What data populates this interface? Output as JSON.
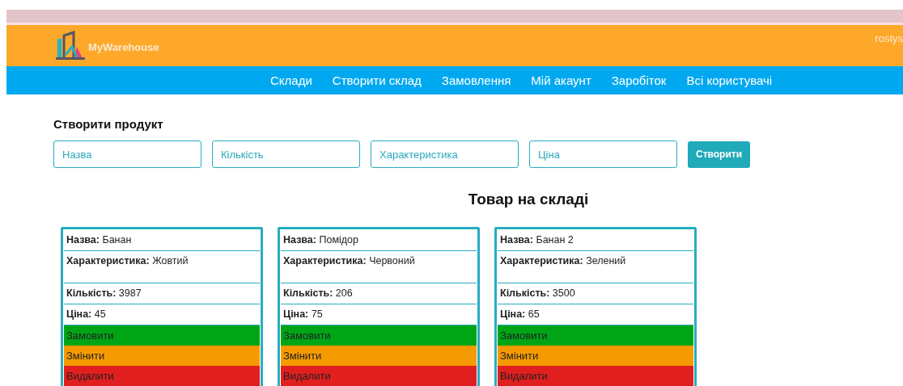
{
  "header": {
    "brand": "MyWarehouse",
    "user": "rostys"
  },
  "nav": [
    "Склади",
    "Створити склад",
    "Замовлення",
    "Мій акаунт",
    "Заробіток",
    "Всі користувачі"
  ],
  "form": {
    "title": "Створити продукт",
    "fields": [
      {
        "placeholder": "Назва"
      },
      {
        "placeholder": "Кількість"
      },
      {
        "placeholder": "Характеристика"
      },
      {
        "placeholder": "Ціна"
      }
    ],
    "submit": "Створити"
  },
  "section_title": "Товар на складі",
  "products": [
    {
      "fields": [
        {
          "label": "Назва:",
          "value": "Банан"
        },
        {
          "label": "Характеристика:",
          "value": "Жовтий"
        },
        {
          "label": "Кількість:",
          "value": "3987"
        },
        {
          "label": "Ціна:",
          "value": "45"
        }
      ],
      "actions": [
        {
          "kind": "order",
          "label": "Замовити"
        },
        {
          "kind": "edit",
          "label": "Змінити"
        },
        {
          "kind": "delete",
          "label": "Видалити"
        }
      ]
    },
    {
      "fields": [
        {
          "label": "Назва:",
          "value": "Помідор"
        },
        {
          "label": "Характеристика:",
          "value": "Червоний"
        },
        {
          "label": "Кількість:",
          "value": "206"
        },
        {
          "label": "Ціна:",
          "value": "75"
        }
      ],
      "actions": [
        {
          "kind": "order",
          "label": "Замовити"
        },
        {
          "kind": "edit",
          "label": "Змінити"
        },
        {
          "kind": "delete",
          "label": "Видалити"
        }
      ]
    },
    {
      "fields": [
        {
          "label": "Назва:",
          "value": "Банан 2"
        },
        {
          "label": "Характеристика:",
          "value": "Зелений"
        },
        {
          "label": "Кількість:",
          "value": "3500"
        },
        {
          "label": "Ціна:",
          "value": "65"
        }
      ],
      "actions": [
        {
          "kind": "order",
          "label": "Замовити"
        },
        {
          "kind": "edit",
          "label": "Змінити"
        },
        {
          "kind": "delete",
          "label": "Видалити"
        }
      ]
    }
  ]
}
